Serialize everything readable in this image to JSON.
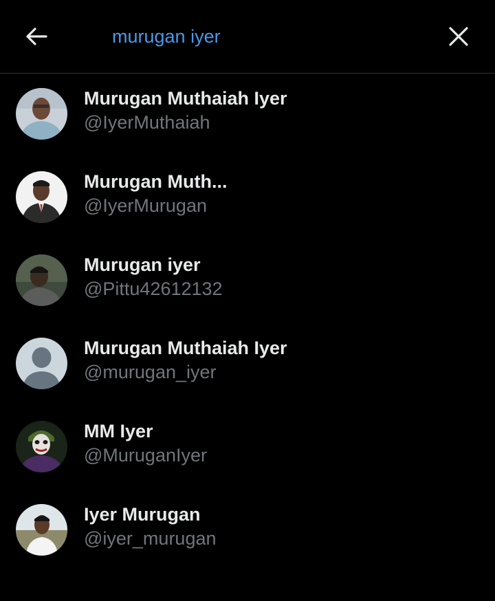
{
  "search": {
    "query": "murugan iyer",
    "back_icon": "arrow-left-icon",
    "clear_icon": "close-icon",
    "accent_color": "#1d9bf0"
  },
  "results": [
    {
      "name": "Murugan Muthaiah Iyer",
      "handle": "@IyerMuthaiah",
      "avatar": "photo-man-glasses"
    },
    {
      "name": "Murugan Muth...",
      "handle": "@IyerMurugan",
      "avatar": "photo-man-suit"
    },
    {
      "name": "Murugan iyer",
      "handle": "@Pittu42612132",
      "avatar": "photo-man-dark"
    },
    {
      "name": "Murugan Muthaiah Iyer",
      "handle": "@murugan_iyer",
      "avatar": "default-avatar"
    },
    {
      "name": "MM Iyer",
      "handle": "@MuruganIyer",
      "avatar": "photo-joker"
    },
    {
      "name": "Iyer Murugan",
      "handle": "@iyer_murugan",
      "avatar": "photo-man-outdoor"
    }
  ]
}
